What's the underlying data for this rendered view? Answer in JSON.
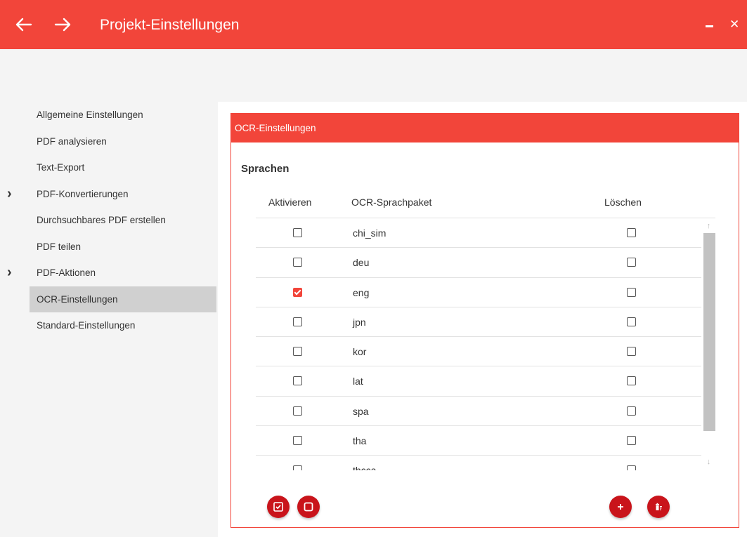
{
  "window": {
    "title": "Projekt-Einstellungen",
    "back_icon": "arrow-left-icon",
    "forward_icon": "arrow-right-icon",
    "accent_color": "#f2453a"
  },
  "sidebar": {
    "items": [
      {
        "label": "Allgemeine Einstellungen",
        "expandable": false
      },
      {
        "label": "PDF analysieren",
        "expandable": false
      },
      {
        "label": "Text-Export",
        "expandable": false
      },
      {
        "label": "PDF-Konvertierungen",
        "expandable": true
      },
      {
        "label": "Durchsuchbares PDF erstellen",
        "expandable": false
      },
      {
        "label": "PDF teilen",
        "expandable": false
      },
      {
        "label": "PDF-Aktionen",
        "expandable": true
      },
      {
        "label": "OCR-Einstellungen",
        "expandable": false,
        "active": true
      },
      {
        "label": "Standard-Einstellungen",
        "expandable": false
      }
    ]
  },
  "panel": {
    "header": "OCR-Einstellungen",
    "section_title": "Sprachen",
    "table": {
      "columns": [
        "Aktivieren",
        "OCR-Sprachpaket",
        "Löschen"
      ],
      "rows": [
        {
          "name": "chi_sim",
          "active": false,
          "delete": false
        },
        {
          "name": "deu",
          "active": false,
          "delete": false
        },
        {
          "name": "eng",
          "active": true,
          "delete": false
        },
        {
          "name": "jpn",
          "active": false,
          "delete": false
        },
        {
          "name": "kor",
          "active": false,
          "delete": false
        },
        {
          "name": "lat",
          "active": false,
          "delete": false
        },
        {
          "name": "spa",
          "active": false,
          "delete": false
        },
        {
          "name": "tha",
          "active": false,
          "delete": false
        },
        {
          "name": "thcca",
          "active": false,
          "delete": false
        }
      ]
    },
    "buttons": {
      "select_all_icon": "checkbox-checked-icon",
      "deselect_all_icon": "checkbox-empty-icon",
      "add_icon": "plus-icon",
      "delete_icon": "trash-icon"
    }
  }
}
